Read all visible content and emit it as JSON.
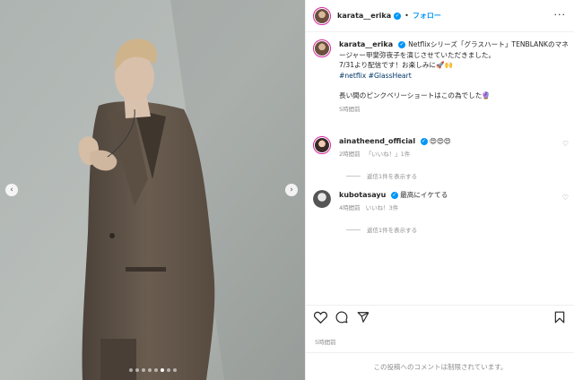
{
  "post": {
    "username": "karata__erika",
    "follow_label": "フォロー",
    "separator": "•",
    "caption_line1": "Netflixシリーズ「グラスハート」TENBLANKのマネージャー甲斐弥夜子を演じさせていただきました。",
    "caption_line2": "7/31より配信です！お楽しみに🚀🙌",
    "hashtags": "#netflix #GlassHeart",
    "caption_line3": "長い間のピンクベリーショートはこの為でした🔮",
    "caption_time": "5時間前",
    "post_time": "5時間前",
    "comments_closed": "この投稿へのコメントは制限されています。"
  },
  "comments": [
    {
      "username": "ainatheend_official",
      "text": "😍😍😍",
      "time": "2時間前",
      "likes": "「いいね！」1件",
      "replies": "返信1件を表示する"
    },
    {
      "username": "kubotasayu",
      "text": "最高にイケてる",
      "time": "4時間前",
      "likes": "いいね！3件",
      "replies": "返信1件を表示する"
    }
  ],
  "icons": {
    "prev": "chevron-left-icon",
    "next": "chevron-right-icon",
    "more": "more-icon",
    "like": "heart-icon",
    "comment": "comment-icon",
    "share": "send-icon",
    "save": "bookmark-icon",
    "verified": "verified-icon"
  },
  "carousel": {
    "total": 8,
    "active_index": 5
  },
  "colors": {
    "accent": "#0095f6",
    "muted": "#8e8e8e",
    "text": "#262626",
    "hashtag": "#00376b"
  }
}
